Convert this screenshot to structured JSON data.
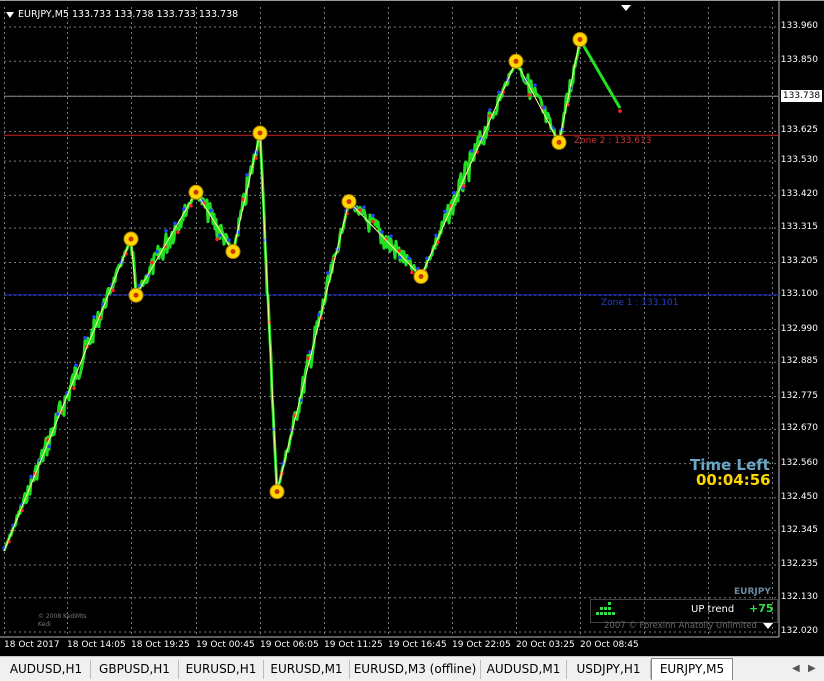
{
  "window": {
    "symbol_info": "EURJPY,M5  133.733 133.738 133.733 133.738",
    "current_price_tag": "133.738"
  },
  "price_axis": [
    {
      "label": "133.960",
      "value": 133.96
    },
    {
      "label": "133.850",
      "value": 133.85
    },
    {
      "label": "133.738",
      "value": 133.738
    },
    {
      "label": "133.625",
      "value": 133.625
    },
    {
      "label": "133.530",
      "value": 133.53
    },
    {
      "label": "133.420",
      "value": 133.42
    },
    {
      "label": "133.315",
      "value": 133.315
    },
    {
      "label": "133.205",
      "value": 133.205
    },
    {
      "label": "133.100",
      "value": 133.1
    },
    {
      "label": "132.990",
      "value": 132.99
    },
    {
      "label": "132.885",
      "value": 132.885
    },
    {
      "label": "132.775",
      "value": 132.775
    },
    {
      "label": "132.670",
      "value": 132.67
    },
    {
      "label": "132.560",
      "value": 132.56
    },
    {
      "label": "132.450",
      "value": 132.45
    },
    {
      "label": "132.345",
      "value": 132.345
    },
    {
      "label": "132.235",
      "value": 132.235
    },
    {
      "label": "132.130",
      "value": 132.13
    },
    {
      "label": "132.020",
      "value": 132.02
    }
  ],
  "time_axis": [
    "18 Oct 2017",
    "18 Oct 14:05",
    "18 Oct 19:25",
    "19 Oct 00:45",
    "19 Oct 06:05",
    "19 Oct 11:25",
    "19 Oct 16:45",
    "19 Oct 22:05",
    "20 Oct 03:25",
    "20 Oct 08:45"
  ],
  "indicators": {
    "time_left_title": "Time Left",
    "time_left_value": "00:04:56",
    "zone2_label": "Zone 2 : 133.613",
    "zone1_label": "Zone 1 : 133.101",
    "trend_symbol": "EURJPY",
    "trend_label": "UP trend",
    "trend_value": "+75",
    "copyright": "2007 © Forexinn Anatoliy Unlimited",
    "small_copy_1": "© 2008 KediMts",
    "small_copy_2": "Kedi"
  },
  "chart_data": {
    "type": "line",
    "title": "",
    "symbol": "EURJPY",
    "timeframe": "M5",
    "ylim": [
      132.02,
      133.96
    ],
    "zigzag_points": [
      {
        "x": "18 Oct 2017",
        "y": 132.28
      },
      {
        "x": "18 Oct 19:25",
        "y": 133.28
      },
      {
        "x": "18 Oct 19:45",
        "y": 133.1
      },
      {
        "x": "19 Oct 00:45",
        "y": 133.43
      },
      {
        "x": "19 Oct 03:50",
        "y": 133.24
      },
      {
        "x": "19 Oct 06:05",
        "y": 133.62
      },
      {
        "x": "19 Oct 07:30",
        "y": 132.47
      },
      {
        "x": "19 Oct 13:30",
        "y": 133.4
      },
      {
        "x": "19 Oct 19:30",
        "y": 133.16
      },
      {
        "x": "20 Oct 03:25",
        "y": 133.85
      },
      {
        "x": "20 Oct 07:00",
        "y": 133.59
      },
      {
        "x": "20 Oct 08:45",
        "y": 133.92
      }
    ],
    "horizontal_lines": [
      {
        "name": "current price",
        "value": 133.738,
        "color": "#888888"
      },
      {
        "name": "Zone 2",
        "value": 133.613,
        "color": "#cc2222"
      },
      {
        "name": "Zone 1",
        "value": 133.101,
        "color": "#2233cc"
      }
    ],
    "colors": {
      "price_line": "#22e022",
      "zigzag": "#ffff99",
      "swing_marker": "#ffd700",
      "bull_dot": "#2244ff",
      "bear_dot": "#ff2222"
    }
  },
  "tabs": [
    {
      "label": "AUDUSD,H1",
      "active": false
    },
    {
      "label": "GBPUSD,H1",
      "active": false
    },
    {
      "label": "EURUSD,H1",
      "active": false
    },
    {
      "label": "EURUSD,M1",
      "active": false
    },
    {
      "label": "EURUSD,M3 (offline)",
      "active": false
    },
    {
      "label": "AUDUSD,M1",
      "active": false
    },
    {
      "label": "USDJPY,H1",
      "active": false
    },
    {
      "label": "EURJPY,M5",
      "active": true
    }
  ]
}
